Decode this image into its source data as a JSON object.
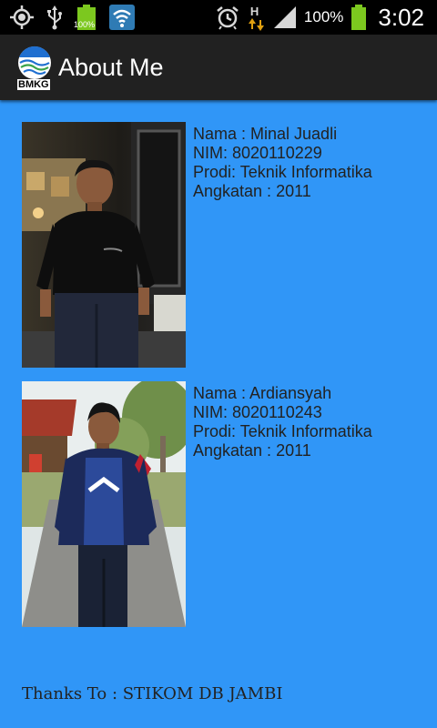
{
  "status_bar": {
    "battery_small_label": "100%",
    "battery_percent": "100%",
    "time": "3:02",
    "network_type": "H"
  },
  "action_bar": {
    "logo_text": "BMKG",
    "title": "About Me"
  },
  "profiles": [
    {
      "name": "Nama : Minal Juadli",
      "nim": "NIM: 8020110229",
      "prodi": "Prodi: Teknik Informatika",
      "angkatan": "Angkatan : 2011"
    },
    {
      "name": "Nama : Ardiansyah",
      "nim": "NIM: 8020110243",
      "prodi": "Prodi: Teknik Informatika",
      "angkatan": "Angkatan : 2011"
    }
  ],
  "footer": {
    "thanks": "Thanks To : STIKOM DB JAMBI"
  },
  "colors": {
    "background": "#3096f7",
    "action_bar": "#212121",
    "status_bar": "#000000",
    "battery_green": "#7cc81f"
  }
}
